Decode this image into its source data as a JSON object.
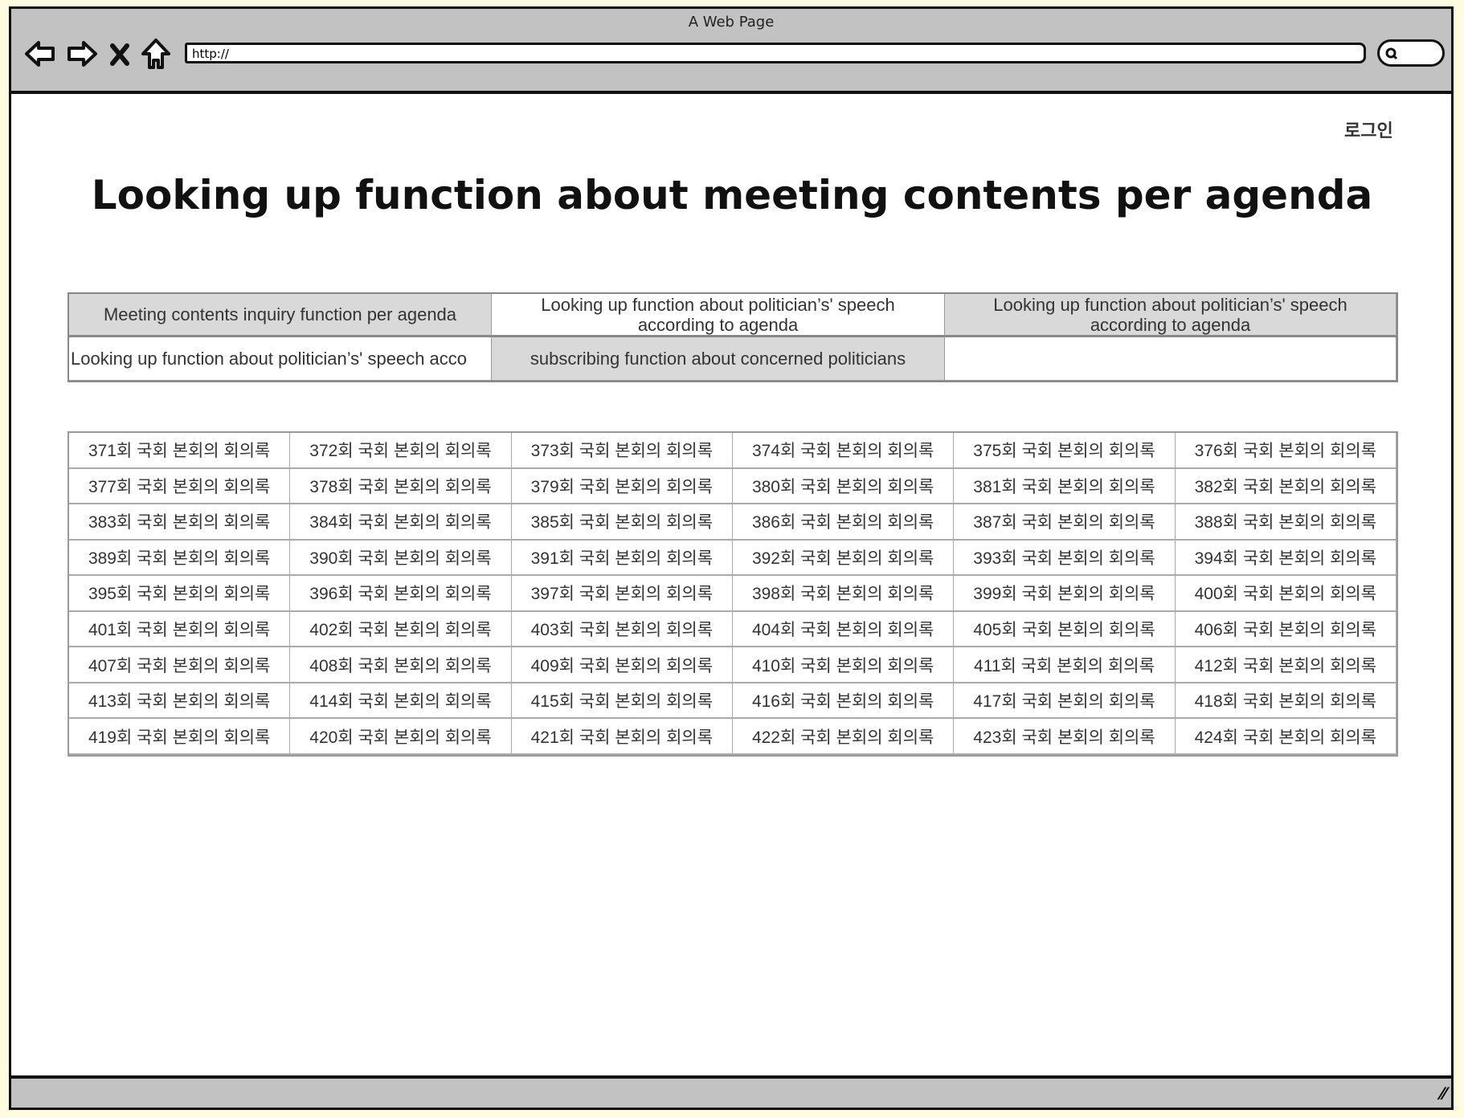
{
  "browser": {
    "window_title": "A Web Page",
    "url": "http://",
    "icons": [
      "back-arrow-icon",
      "forward-arrow-icon",
      "close-x-icon",
      "home-icon",
      "search-icon",
      "resize-grip-icon"
    ]
  },
  "header": {
    "login_label": "로그인",
    "title": "Looking up function about meeting contents per agenda"
  },
  "nav": [
    {
      "label": "Meeting contents inquiry function per agenda",
      "highlighted": true
    },
    {
      "label": "Looking up  function about politician’s' speech according to agenda",
      "highlighted": false
    },
    {
      "label": "Looking up  function about politician’s' speech according to agenda",
      "highlighted": true
    },
    {
      "label": "Looking up  function about politician’s' speech acco",
      "highlighted": false
    },
    {
      "label": "subscribing function about concerned politicians",
      "highlighted": true
    },
    {
      "label": "",
      "highlighted": false
    }
  ],
  "records": [
    "371회 국회 본회의 회의록",
    "372회 국회 본회의 회의록",
    "373회 국회 본회의 회의록",
    "374회 국회 본회의 회의록",
    "375회 국회 본회의 회의록",
    "376회 국회 본회의 회의록",
    "377회 국회 본회의 회의록",
    "378회 국회 본회의 회의록",
    "379회 국회 본회의 회의록",
    "380회 국회 본회의 회의록",
    "381회 국회 본회의 회의록",
    "382회 국회 본회의 회의록",
    "383회 국회 본회의 회의록",
    "384회 국회 본회의 회의록",
    "385회 국회 본회의 회의록",
    "386회 국회 본회의 회의록",
    "387회 국회 본회의 회의록",
    "388회 국회 본회의 회의록",
    "389회 국회 본회의 회의록",
    "390회 국회 본회의 회의록",
    "391회 국회 본회의 회의록",
    "392회 국회 본회의 회의록",
    "393회 국회 본회의 회의록",
    "394회 국회 본회의 회의록",
    "395회 국회 본회의 회의록",
    "396회 국회 본회의 회의록",
    "397회 국회 본회의 회의록",
    "398회 국회 본회의 회의록",
    "399회 국회 본회의 회의록",
    "400회 국회 본회의 회의록",
    "401회 국회 본회의 회의록",
    "402회 국회 본회의 회의록",
    "403회 국회 본회의 회의록",
    "404회 국회 본회의 회의록",
    "405회 국회 본회의 회의록",
    "406회 국회 본회의 회의록",
    "407회 국회 본회의 회의록",
    "408회 국회 본회의 회의록",
    "409회 국회 본회의 회의록",
    "410회 국회 본회의 회의록",
    "411회 국회 본회의 회의록",
    "412회 국회 본회의 회의록",
    "413회 국회 본회의 회의록",
    "414회 국회 본회의 회의록",
    "415회 국회 본회의 회의록",
    "416회 국회 본회의 회의록",
    "417회 국회 본회의 회의록",
    "418회 국회 본회의 회의록",
    "419회 국회 본회의 회의록",
    "420회 국회 본회의 회의록",
    "421회 국회 본회의 회의록",
    "422회 국회 본회의 회의록",
    "423회 국회 본회의 회의록",
    "424회 국회 본회의 회의록"
  ],
  "colors": {
    "chrome": "#c2c2c2",
    "highlight": "#d9d9d9",
    "frame": "#111111"
  }
}
